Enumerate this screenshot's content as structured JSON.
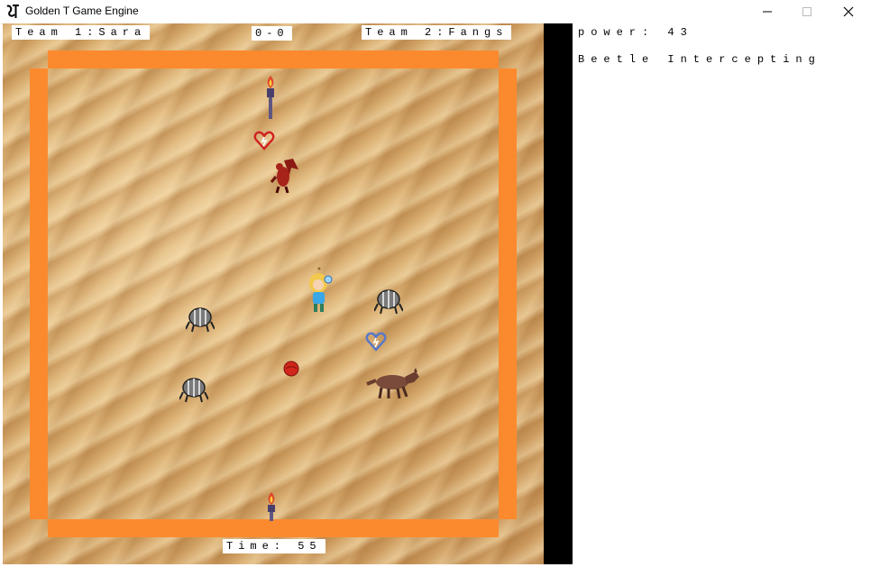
{
  "window": {
    "title": "Golden T Game Engine",
    "icon": "golden-t-logo-icon",
    "controls": [
      "minimize-icon",
      "maximize-icon",
      "close-icon"
    ]
  },
  "hud": {
    "team1": "Team 1:Sara",
    "score": "0-0",
    "team2": "Team 2:Fangs",
    "timer": "Time: 55"
  },
  "side_panel": {
    "power": "power: 43",
    "status": "Beetle Intercepting"
  },
  "field": {
    "border_color": "#fb8a2e",
    "sprites": [
      "torch-goal-top",
      "red-heart-crystal",
      "red-dragon-player",
      "blonde-girl-player",
      "beetle-bot",
      "beetle-bot",
      "beetle-bot",
      "blue-heart-crystal",
      "red-ball",
      "wolf-player",
      "torch-goal-bottom"
    ]
  }
}
